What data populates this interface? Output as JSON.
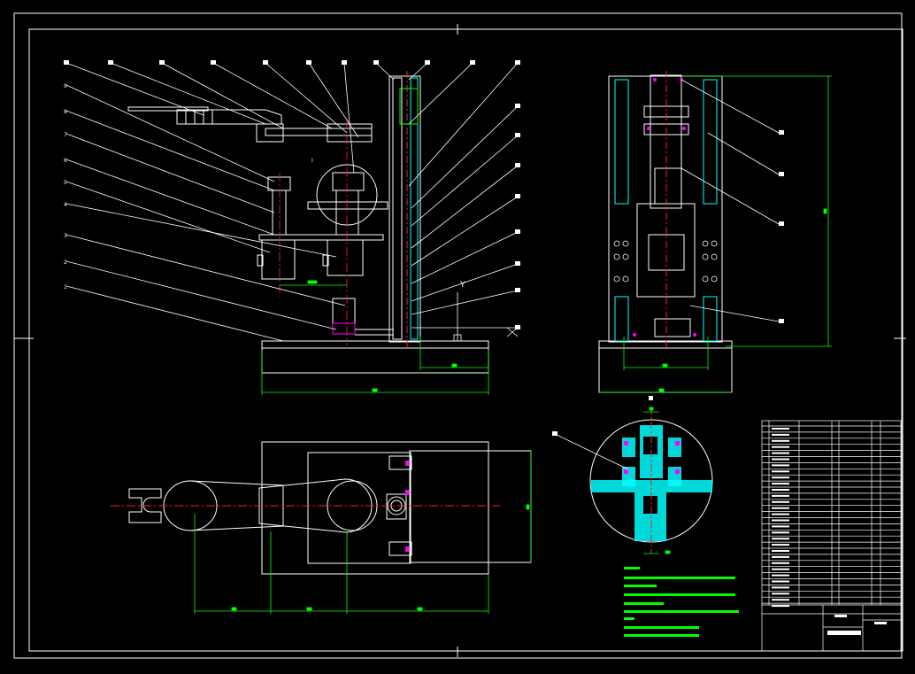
{
  "drawing": {
    "colors": {
      "background": "#000000",
      "outline": "#ffffff",
      "centerline": "#ff2020",
      "dimension": "#00ff00",
      "accent": "#ff00ff",
      "hatch": "#00ffff",
      "part_number_box": "#ffffff"
    },
    "balloon_labels_left": [
      "9",
      "8",
      "7",
      "6",
      "5",
      "4",
      "3",
      "2",
      "1"
    ],
    "detail_label": "I",
    "view_letter": "Y"
  }
}
